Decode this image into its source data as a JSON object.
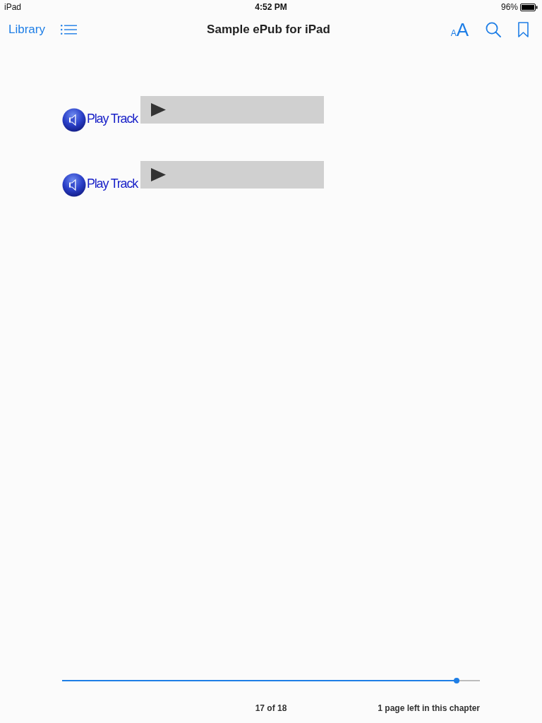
{
  "status_bar": {
    "device": "iPad",
    "time": "4:52 PM",
    "battery": "96%"
  },
  "nav_bar": {
    "back_button": "Library",
    "title": "Sample ePub for iPad",
    "text_size_button": {
      "small": "A",
      "large": "A"
    }
  },
  "tracks": [
    {
      "label": "Play Track"
    },
    {
      "label": "Play Track"
    }
  ],
  "footer": {
    "progress": {
      "level": 0.944
    },
    "page": "17 of 18",
    "chapter_remaining": "1 page left in this chapter"
  }
}
